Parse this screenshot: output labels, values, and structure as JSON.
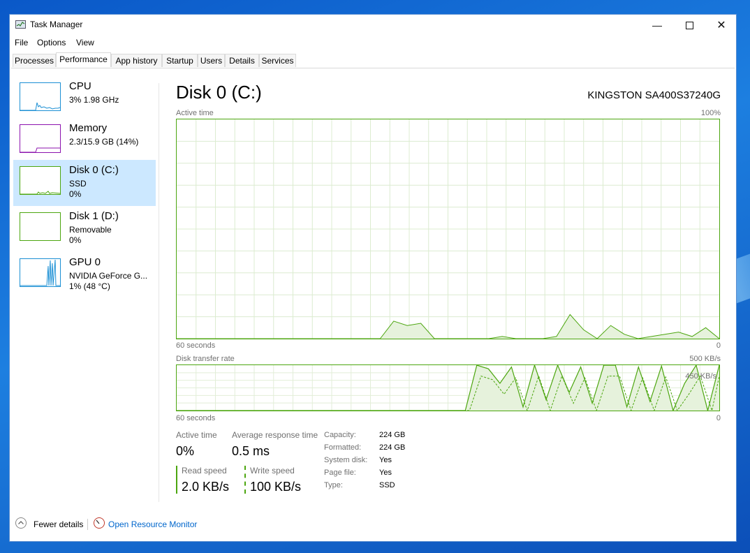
{
  "window": {
    "title": "Task Manager"
  },
  "menu": [
    "File",
    "Options",
    "View"
  ],
  "tabs": [
    "Processes",
    "Performance",
    "App history",
    "Startup",
    "Users",
    "Details",
    "Services"
  ],
  "active_tab": "Performance",
  "sidebar": [
    {
      "name": "CPU",
      "line1": "3%  1.98 GHz",
      "line2": ""
    },
    {
      "name": "Memory",
      "line1": "2.3/15.9 GB (14%)",
      "line2": ""
    },
    {
      "name": "Disk 0 (C:)",
      "line1": "SSD",
      "line2": "0%"
    },
    {
      "name": "Disk 1 (D:)",
      "line1": "Removable",
      "line2": "0%"
    },
    {
      "name": "GPU 0",
      "line1": "NVIDIA GeForce G...",
      "line2": "1% (48 °C)"
    }
  ],
  "main": {
    "title": "Disk 0 (C:)",
    "model": "KINGSTON SA400S37240G",
    "active_graph": {
      "label": "Active time",
      "max": "100%",
      "time": "60 seconds",
      "min": "0"
    },
    "transfer_graph": {
      "label": "Disk transfer rate",
      "max": "500 KB/s",
      "mid": "450 KB/s",
      "time": "60 seconds",
      "min": "0"
    },
    "stats": {
      "active_time_label": "Active time",
      "active_time": "0%",
      "avg_response_label": "Average response time",
      "avg_response": "0.5 ms",
      "read_label": "Read speed",
      "read": "2.0 KB/s",
      "write_label": "Write speed",
      "write": "100 KB/s"
    },
    "props": [
      {
        "label": "Capacity:",
        "value": "224 GB"
      },
      {
        "label": "Formatted:",
        "value": "224 GB"
      },
      {
        "label": "System disk:",
        "value": "Yes"
      },
      {
        "label": "Page file:",
        "value": "Yes"
      },
      {
        "label": "Type:",
        "value": "SSD"
      }
    ]
  },
  "footer": {
    "fewer": "Fewer details",
    "monitor": "Open Resource Monitor"
  },
  "colors": {
    "disk_green": "#4ca60f",
    "cpu_blue": "#1b8fd4",
    "memory_purple": "#8b12ae",
    "selected_bg": "#cce8ff"
  },
  "chart_data": [
    {
      "type": "area",
      "title": "Active time",
      "x": [
        60,
        58,
        56,
        54,
        52,
        50,
        48,
        46,
        44,
        42,
        40,
        38,
        36,
        34,
        32,
        30,
        28,
        26,
        24,
        22,
        20,
        18,
        16,
        14,
        12,
        10,
        8,
        6,
        4,
        2,
        0
      ],
      "ylim": [
        0,
        100
      ],
      "series": [
        {
          "values": [
            0,
            0,
            0,
            0,
            0,
            0,
            0,
            0,
            0,
            0,
            0,
            0,
            0,
            0,
            0,
            0,
            8,
            6,
            7,
            0,
            0,
            0,
            0,
            0,
            1,
            0,
            0,
            0,
            1,
            11,
            4,
            0,
            6,
            2,
            0,
            1,
            2,
            3,
            1,
            5,
            0
          ]
        }
      ]
    },
    {
      "type": "line",
      "title": "Disk transfer rate",
      "ylim": [
        0,
        500
      ],
      "series": [
        {
          "values": [
            0,
            0,
            0,
            0,
            0,
            0,
            0,
            0,
            0,
            0,
            0,
            0,
            0,
            0,
            0,
            0,
            0,
            0,
            0,
            0,
            0,
            0,
            0,
            0,
            0,
            0,
            500,
            460,
            300,
            480,
            40,
            500,
            120,
            500,
            200,
            480,
            80,
            500,
            500,
            40,
            480,
            100,
            490,
            0,
            300,
            500,
            0,
            500
          ]
        }
      ]
    }
  ]
}
